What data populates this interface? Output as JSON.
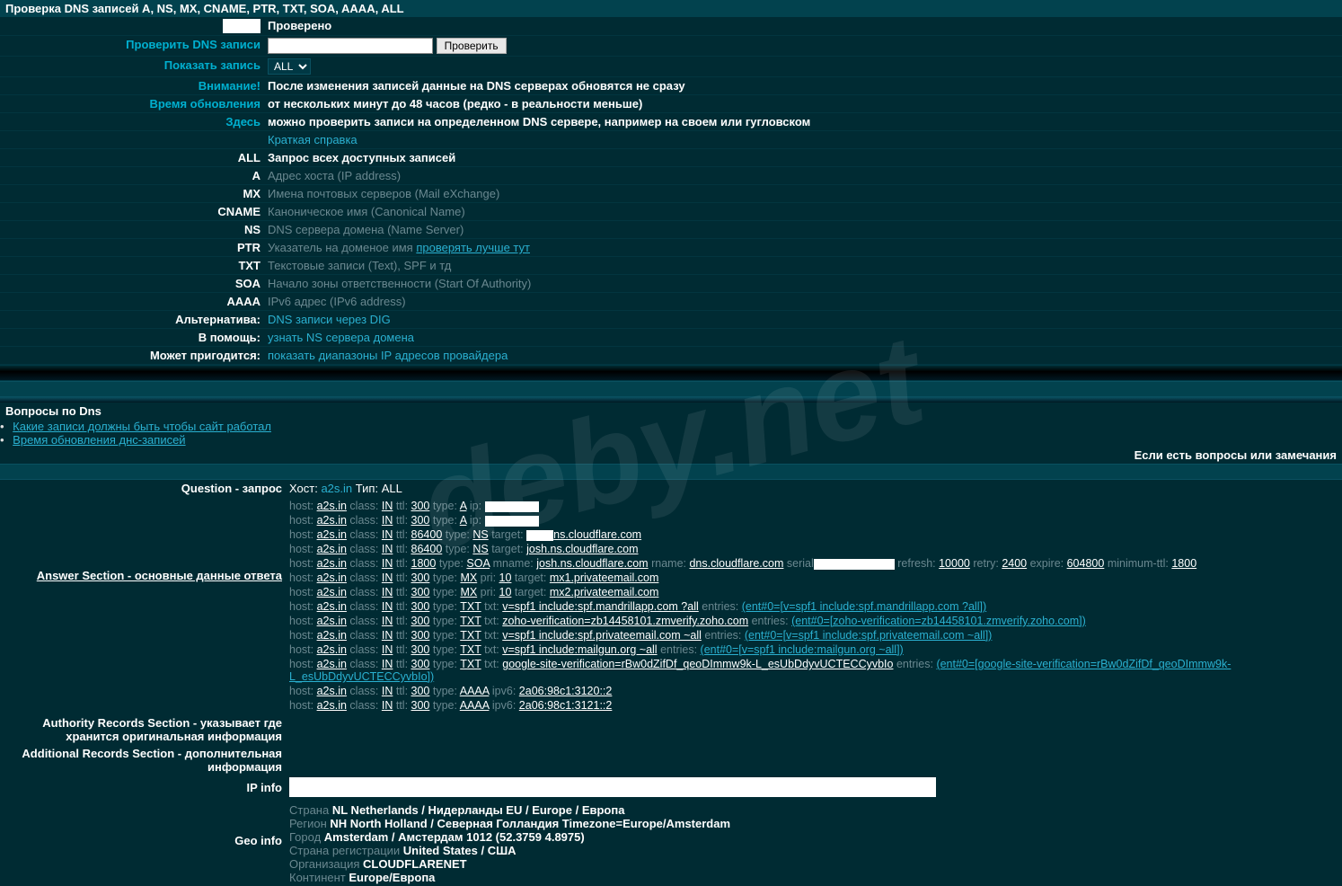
{
  "title": "Проверка DNS записей A, NS, MX, CNAME, PTR, TXT, SOA, AAAA, ALL",
  "watermark": "deby.net",
  "rows": {
    "checked": {
      "label": "",
      "value": "Проверено"
    },
    "check": {
      "label": "Проверить DNS записи",
      "btn": "Проверить"
    },
    "show": {
      "label": "Показать запись",
      "select": "ALL"
    },
    "warning": {
      "label": "Внимание!",
      "value": "После изменения записей данные на DNS серверах обновятся не сразу"
    },
    "updtime": {
      "label": "Время обновления",
      "value": "от нескольких минут до 48 часов (редко - в реальности меньше)"
    },
    "here": {
      "label": "Здесь",
      "value": "можно проверить записи на определенном DNS сервере, например на своем или гугловском"
    },
    "brief": {
      "label": "",
      "value": "Краткая справка"
    },
    "all": {
      "label": "ALL",
      "value": "Запрос всех доступных записей"
    },
    "a": {
      "label": "A",
      "value": "Адрес хоста (IP address)"
    },
    "mx": {
      "label": "MX",
      "value": "Имена почтовых серверов (Mail eXchange)"
    },
    "cname": {
      "label": "CNAME",
      "value": "Каноническое имя (Canonical Name)"
    },
    "ns": {
      "label": "NS",
      "value": "DNS сервера домена (Name Server)"
    },
    "ptr": {
      "label": "PTR",
      "value": "Указатель на доменое имя",
      "link": "проверять лучше тут"
    },
    "txt": {
      "label": "TXT",
      "value": "Текстовые записи (Text), SPF и тд"
    },
    "soa": {
      "label": "SOA",
      "value": "Начало зоны ответственности (Start Of Authority)"
    },
    "aaaa": {
      "label": "AAAA",
      "value": "IPv6 адрес (IPv6 address)"
    },
    "alt": {
      "label": "Альтернатива:",
      "link": "DNS записи через DIG"
    },
    "help": {
      "label": "В помощь:",
      "link": "узнать NS сервера домена"
    },
    "useful": {
      "label": "Может пригодится:",
      "link": "показать диапазоны IP адресов провайдера"
    }
  },
  "questions": {
    "title": "Вопросы по Dns",
    "items": [
      "Какие записи должны быть чтобы сайт работал",
      "Время обновления днс-записей"
    ],
    "footnote": "Если есть вопросы или замечания"
  },
  "question_section": {
    "label": "Question - запрос",
    "host_label": "Хост:",
    "host": "a2s.in",
    "type_label": "Тип:",
    "type": "ALL"
  },
  "answer_label": "Answer Section - основные данные ответа",
  "records": [
    {
      "host": "a2s.in",
      "class": "IN",
      "ttl": "300",
      "type": "A",
      "extra": "ip:",
      "redact": 60
    },
    {
      "host": "a2s.in",
      "class": "IN",
      "ttl": "300",
      "type": "A",
      "extra": "ip:",
      "redact": 60
    },
    {
      "host": "a2s.in",
      "class": "IN",
      "ttl": "86400",
      "type": "NS",
      "extra": "target:",
      "redact": 30,
      "tail": "ns.cloudflare.com"
    },
    {
      "host": "a2s.in",
      "class": "IN",
      "ttl": "86400",
      "type": "NS",
      "extra": "target:",
      "tail2": "josh.ns.cloudflare.com"
    },
    {
      "host": "a2s.in",
      "class": "IN",
      "ttl": "1800",
      "type": "SOA",
      "soa": true
    },
    {
      "host": "a2s.in",
      "class": "IN",
      "ttl": "300",
      "type": "MX",
      "mx": true,
      "pri": "10",
      "target": "mx1.privateemail.com"
    },
    {
      "host": "a2s.in",
      "class": "IN",
      "ttl": "300",
      "type": "MX",
      "mx": true,
      "pri": "10",
      "target": "mx2.privateemail.com"
    },
    {
      "host": "a2s.in",
      "class": "IN",
      "ttl": "300",
      "type": "TXT",
      "txt": "v=spf1 include:spf.mandrillapp.com ?all",
      "entries": "(ent#0=[v=spf1 include:spf.mandrillapp.com ?all])"
    },
    {
      "host": "a2s.in",
      "class": "IN",
      "ttl": "300",
      "type": "TXT",
      "txt": "zoho-verification=zb14458101.zmverify.zoho.com",
      "entries": "(ent#0=[zoho-verification=zb14458101.zmverify.zoho.com])"
    },
    {
      "host": "a2s.in",
      "class": "IN",
      "ttl": "300",
      "type": "TXT",
      "txt": "v=spf1 include:spf.privateemail.com ~all",
      "entries": "(ent#0=[v=spf1 include:spf.privateemail.com ~all])"
    },
    {
      "host": "a2s.in",
      "class": "IN",
      "ttl": "300",
      "type": "TXT",
      "txt": "v=spf1 include:mailgun.org ~all",
      "entries": "(ent#0=[v=spf1 include:mailgun.org ~all])"
    },
    {
      "host": "a2s.in",
      "class": "IN",
      "ttl": "300",
      "type": "TXT",
      "txt": "google-site-verification=rBw0dZifDf_qeoDImmw9k-L_esUbDdyvUCTECCyvbIo",
      "entries": "(ent#0=[google-site-verification=rBw0dZifDf_qeoDImmw9k-L_esUbDdyvUCTECCyvbIo])"
    },
    {
      "host": "a2s.in",
      "class": "IN",
      "ttl": "300",
      "type": "AAAA",
      "ipv6": "2a06:98c1:3120::2"
    },
    {
      "host": "a2s.in",
      "class": "IN",
      "ttl": "300",
      "type": "AAAA",
      "ipv6": "2a06:98c1:3121::2"
    }
  ],
  "soa": {
    "mname": "josh.ns.cloudflare.com",
    "rname": "dns.cloudflare.com",
    "refresh": "10000",
    "retry": "2400",
    "expire": "604800",
    "minttl": "1800"
  },
  "authority_label": "Authority Records Section - указывает где хранится оригинальная информация",
  "additional_label": "Additional Records Section - дополнительная информация",
  "ip_info_label": "IP info",
  "geo_label": "Geo info",
  "geo": {
    "country_l": "Страна",
    "country_v": "NL Netherlands / Нидерланды EU / Europe / Европа",
    "region_l": "Регион",
    "region_v": "NH North Holland / Северная Голландия Timezone=Europe/Amsterdam",
    "city_l": "Город",
    "city_v": "Amsterdam / Амстердам 1012 (52.3759 4.8975)",
    "reg_l": "Страна регистрации",
    "reg_v": "United States / США",
    "org_l": "Организация",
    "org_v": "CLOUDFLARENET",
    "cont_l": "Континент",
    "cont_v": "Europe/Европа"
  }
}
